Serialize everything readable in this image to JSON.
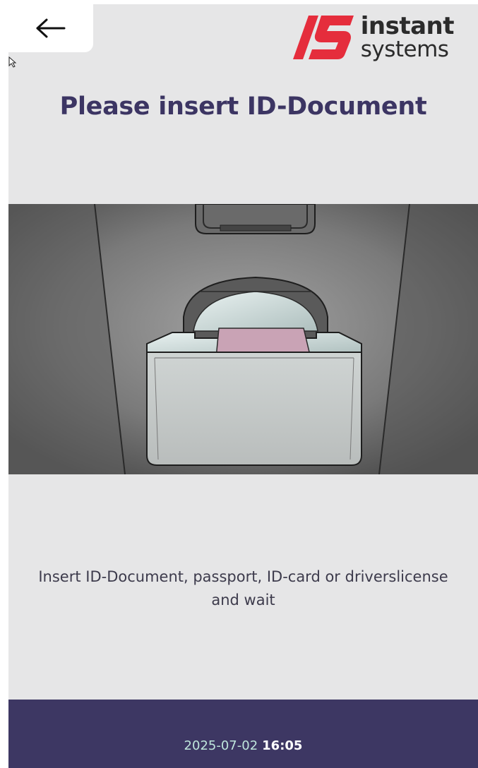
{
  "header": {
    "back_icon": "arrow-left-icon",
    "logo": {
      "mark": "instant-systems-logo-icon",
      "line1": "instant",
      "line2": "systems",
      "brand_color": "#e52d3c"
    }
  },
  "main": {
    "title": "Please insert ID-Document",
    "illustration": "id-document-reader-icon",
    "instruction": "Insert ID-Document, passport, ID-card or driverslicense and wait"
  },
  "footer": {
    "date": "2025-07-02",
    "time": "16:05"
  },
  "colors": {
    "background": "#e6e6e7",
    "title": "#3c3563",
    "footer_bg": "#3d3763",
    "date_text": "#bfe6dc",
    "card": "#c9a3b5"
  }
}
